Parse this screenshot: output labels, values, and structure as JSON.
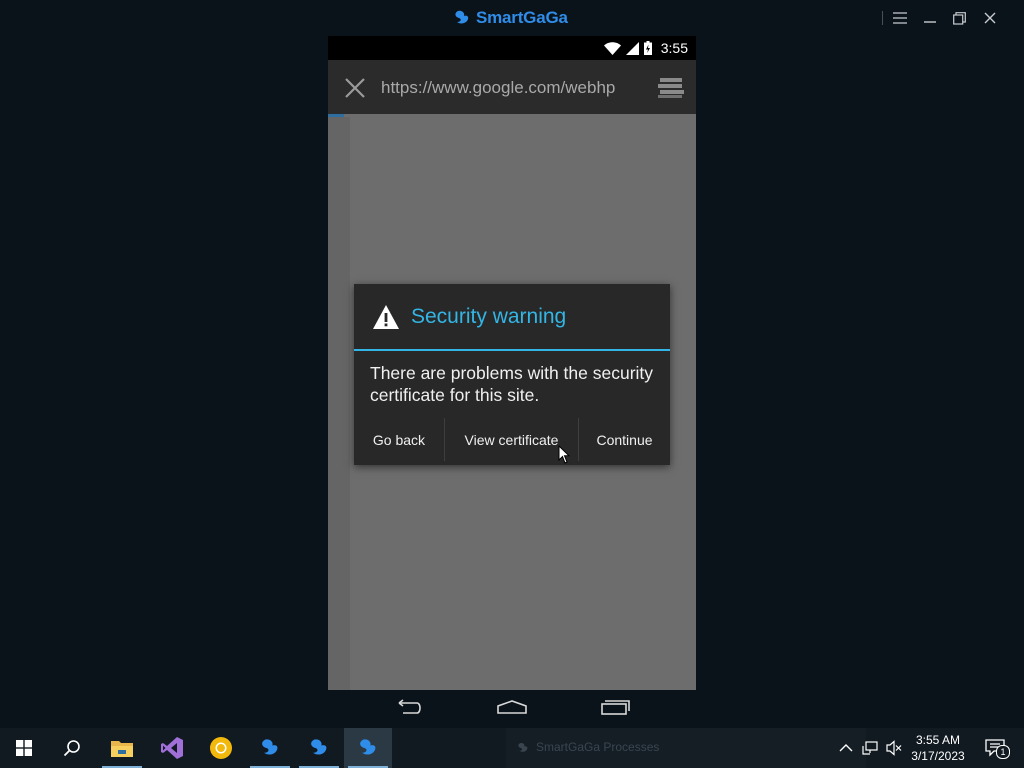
{
  "window": {
    "app_name": "SmartGaGa",
    "controls": [
      "hamburger-icon",
      "minimize-icon",
      "restore-icon",
      "close-icon"
    ]
  },
  "phone": {
    "status_bar": {
      "time": "3:55",
      "icons": [
        "wifi-icon",
        "signal-icon",
        "battery-charging-icon"
      ]
    },
    "browser": {
      "url": "https://www.google.com/webhp",
      "close_icon": "close-icon",
      "menu_icon": "tabs-menu-icon"
    },
    "dialog": {
      "title": "Security warning",
      "message": "There are problems with the security certificate for this site.",
      "buttons": [
        "Go back",
        "View certificate",
        "Continue"
      ],
      "accent": "#33b5e5"
    },
    "nav": [
      "back-icon",
      "home-icon",
      "recent-apps-icon"
    ]
  },
  "taskbar": {
    "apps": [
      "start-icon",
      "search-icon",
      "file-explorer-icon",
      "visual-studio-icon",
      "chrome-icon",
      "smartgaga-icon",
      "smartgaga-icon",
      "smartgaga-icon"
    ],
    "notify_text": "SmartGaGa Processes",
    "clock_time": "3:55 AM",
    "clock_date": "3/17/2023",
    "notification_count": "1"
  }
}
